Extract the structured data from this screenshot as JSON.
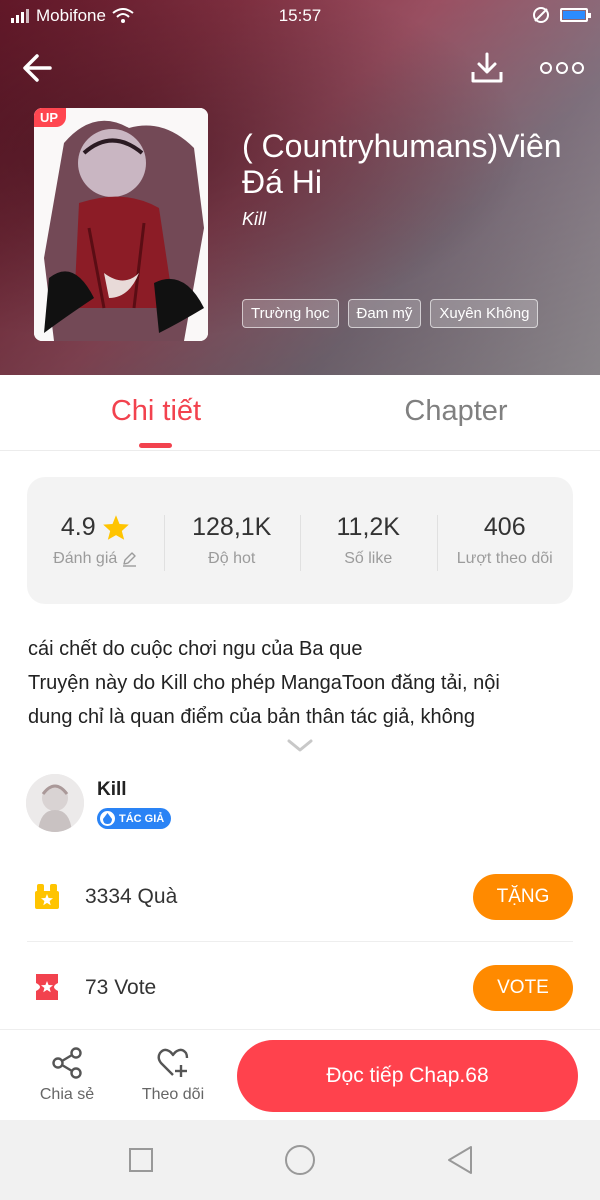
{
  "status_bar": {
    "carrier": "Mobifone",
    "time": "15:57"
  },
  "story": {
    "title": "( Countryhumans)Viên Đá Hi",
    "author": "Kill",
    "badge": "UP",
    "tags": [
      "Trường học",
      "Đam mỹ",
      "Xuyên Không"
    ]
  },
  "tabs": [
    {
      "label": "Chi tiết",
      "active": true
    },
    {
      "label": "Chapter",
      "active": false
    }
  ],
  "stats": [
    {
      "value": "4.9",
      "label": "Đánh giá"
    },
    {
      "value": "128,1K",
      "label": "Độ hot"
    },
    {
      "value": "11,2K",
      "label": "Số like"
    },
    {
      "value": "406",
      "label": "Lượt theo dõi"
    }
  ],
  "description": {
    "line1": "cái chết do cuộc chơi ngu của Ba que",
    "line2": "Truyện này do Kill cho phép MangaToon đăng tải, nội",
    "line3": "dung chỉ là quan điểm của bản thân tác giả, không"
  },
  "author_card": {
    "name": "Kill",
    "role": "TÁC GIẢ"
  },
  "gift_row": {
    "label": "3334  Quà",
    "button": "TẶNG"
  },
  "vote_row": {
    "label": "73  Vote",
    "button": "VOTE"
  },
  "bottom_bar": {
    "share": "Chia sẻ",
    "follow": "Theo dõi",
    "continue": "Đọc tiếp Chap.68"
  },
  "colors": {
    "accent": "#f2424e",
    "orange": "#ff8a00",
    "star": "#ffc400",
    "badge_blue": "#2a83f5"
  }
}
